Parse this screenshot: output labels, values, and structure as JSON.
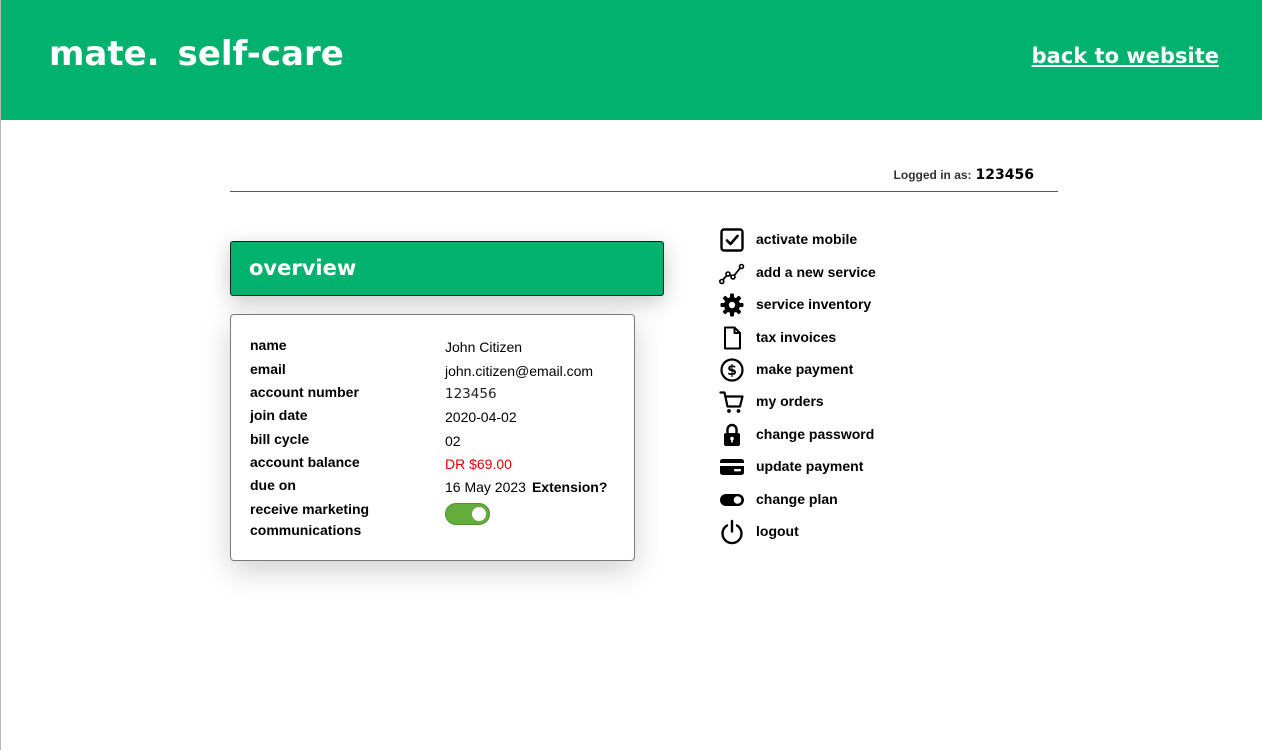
{
  "header": {
    "brand_primary": "mate.",
    "brand_secondary": "self-care",
    "back_link": "back to website",
    "color": "#00b26d"
  },
  "session": {
    "logged_in_label": "Logged in as:",
    "logged_in_value": "123456"
  },
  "overview": {
    "title": "overview",
    "fields": {
      "name": {
        "label": "name",
        "value": "John Citizen"
      },
      "email": {
        "label": "email",
        "value": "john.citizen@email.com"
      },
      "account_number": {
        "label": "account number",
        "value": "123456"
      },
      "join_date": {
        "label": "join date",
        "value": "2020-04-02"
      },
      "bill_cycle": {
        "label": "bill cycle",
        "value": "02"
      },
      "account_balance": {
        "label": "account balance",
        "value": "DR $69.00",
        "color": "#e60000"
      },
      "due_on": {
        "label": "due on",
        "value": "16 May 2023",
        "extension": "Extension?"
      },
      "marketing": {
        "label": "receive marketing communications",
        "enabled": true,
        "color": "#63ad3a"
      }
    }
  },
  "menu": {
    "items": [
      {
        "label": "activate mobile",
        "icon": "checkbox-icon"
      },
      {
        "label": "add a new service",
        "icon": "trend-line-icon"
      },
      {
        "label": "service inventory",
        "icon": "gear-icon"
      },
      {
        "label": "tax invoices",
        "icon": "document-icon"
      },
      {
        "label": "make payment",
        "icon": "dollar-circle-icon"
      },
      {
        "label": "my orders",
        "icon": "cart-icon"
      },
      {
        "label": "change password",
        "icon": "lock-icon"
      },
      {
        "label": "update payment",
        "icon": "credit-card-icon"
      },
      {
        "label": "change plan",
        "icon": "toggle-icon"
      },
      {
        "label": "logout",
        "icon": "power-icon"
      }
    ]
  }
}
